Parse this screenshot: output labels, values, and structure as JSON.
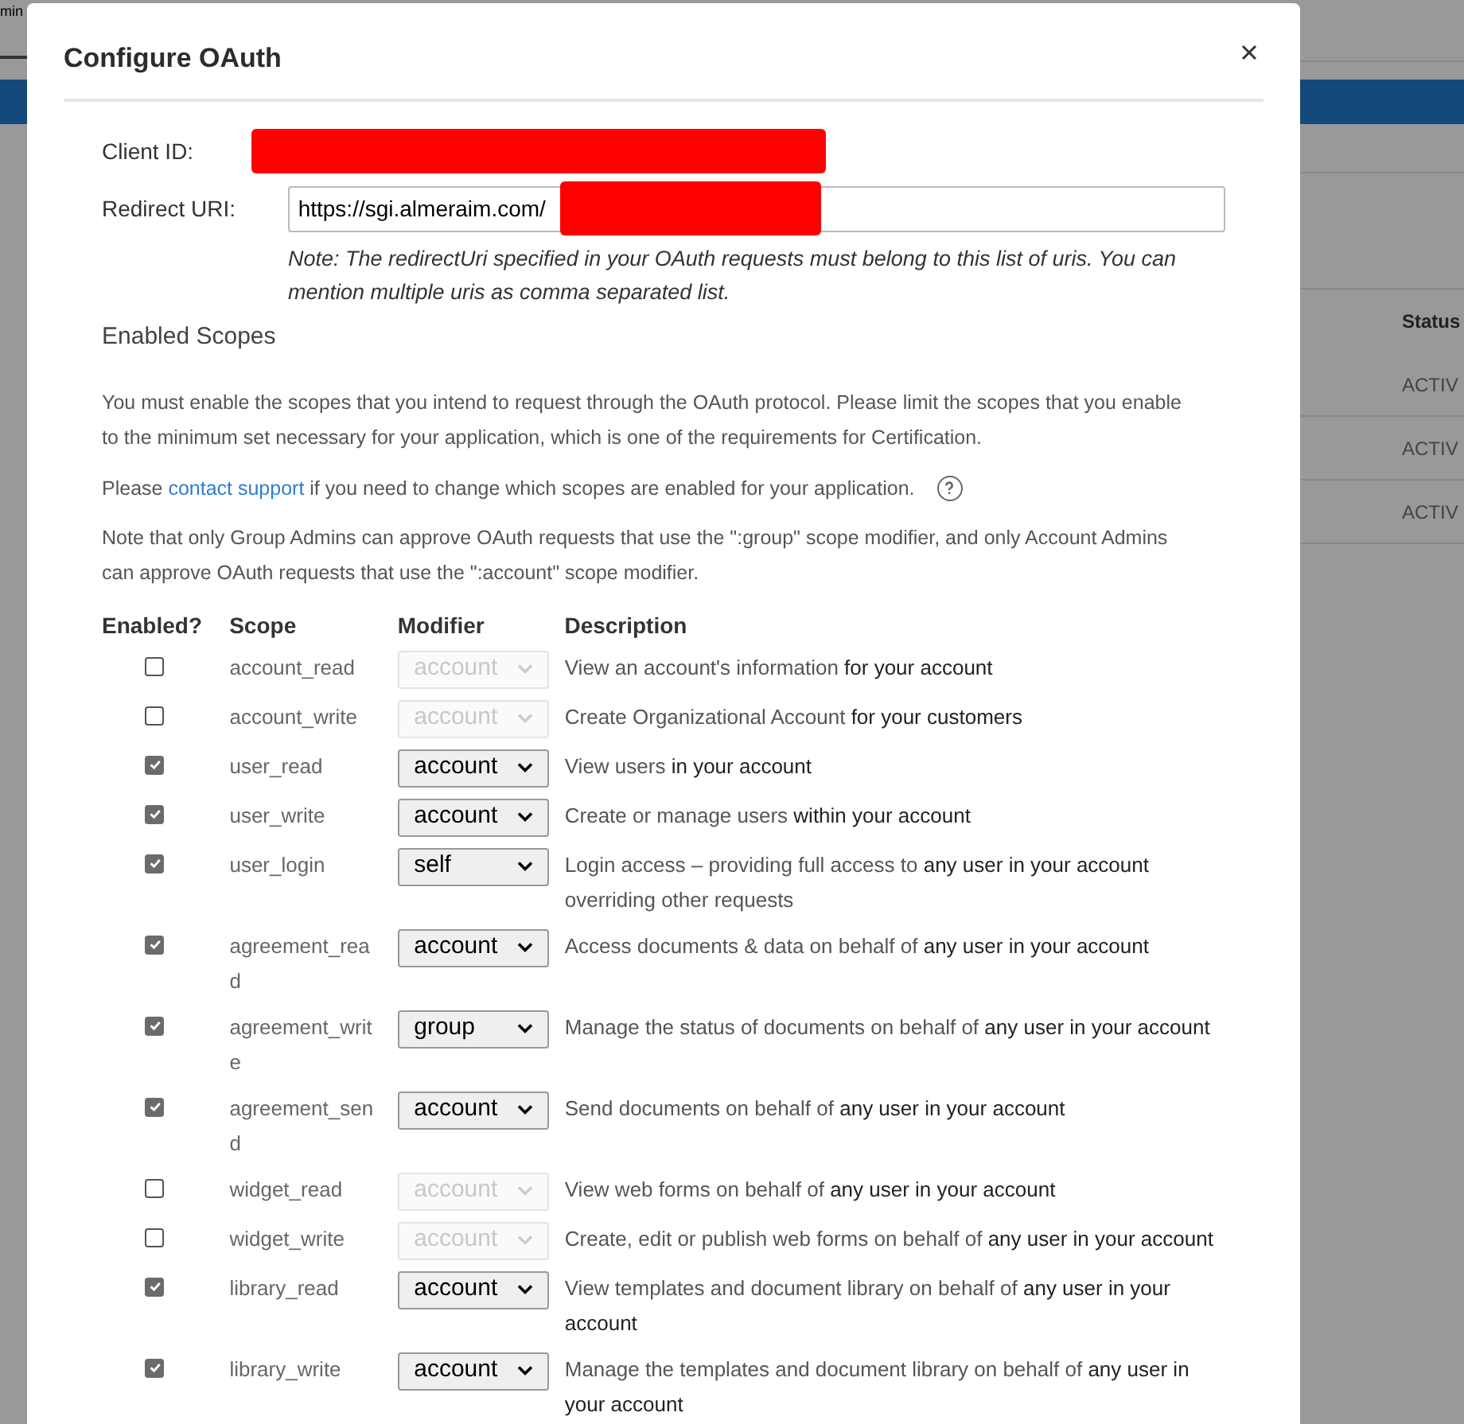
{
  "background": {
    "tab_label": "min",
    "status_header": "Status",
    "status_cells": [
      "ACTIV",
      "ACTIV",
      "ACTIV"
    ]
  },
  "dialog": {
    "title": "Configure OAuth",
    "client_id": {
      "label": "Client ID:"
    },
    "redirect_uri": {
      "label": "Redirect URI:",
      "value": "https://sgi.almeraim.com/"
    },
    "note": "Note: The redirectUri specified in your OAuth requests must belong to this list of uris. You can mention multiple uris as comma separated list.",
    "section_title": "Enabled Scopes",
    "intro": "You must enable the scopes that you intend to request through the OAuth protocol. Please limit the scopes that you enable to the minimum set necessary for your application, which is one of the requirements for Certification.",
    "support": {
      "before": "Please",
      "link": "contact support",
      "after": "if you need to change which scopes are enabled for your application."
    },
    "admin_note": "Note that only Group Admins can approve OAuth requests that use the \":group\" scope modifier, and only Account Admins can approve OAuth requests that use the \":account\" scope modifier.",
    "columns": [
      "Enabled?",
      "Scope",
      "Modifier",
      "Description"
    ],
    "rows": [
      {
        "enabled": false,
        "scope": "account_read",
        "modifier": "account",
        "description": "View an account's information **for your account**"
      },
      {
        "enabled": false,
        "scope": "account_write",
        "modifier": "account",
        "description": "Create Organizational Account **for your customers**"
      },
      {
        "enabled": true,
        "scope": "user_read",
        "modifier": "account",
        "description": "View users **in your account**"
      },
      {
        "enabled": true,
        "scope": "user_write",
        "modifier": "account",
        "description": "Create or manage users **within your account**"
      },
      {
        "enabled": true,
        "scope": "user_login",
        "modifier": "self",
        "description": "Login access – providing full access to **any user in your account** overriding other requests"
      },
      {
        "enabled": true,
        "scope": "agreement_read",
        "modifier": "account",
        "description": "Access documents & data on behalf of **any user in your account**"
      },
      {
        "enabled": true,
        "scope": "agreement_write",
        "modifier": "group",
        "description": "Manage the status of documents on behalf of **any user in your account**"
      },
      {
        "enabled": true,
        "scope": "agreement_send",
        "modifier": "account",
        "description": "Send documents on behalf of **any user in your account**"
      },
      {
        "enabled": false,
        "scope": "widget_read",
        "modifier": "account",
        "description": "View web forms on behalf of **any user in your account**"
      },
      {
        "enabled": false,
        "scope": "widget_write",
        "modifier": "account",
        "description": "Create, edit or publish web forms on behalf of **any user in your account**"
      },
      {
        "enabled": true,
        "scope": "library_read",
        "modifier": "account",
        "description": "View templates and document library on behalf of **any user in your account**"
      },
      {
        "enabled": true,
        "scope": "library_write",
        "modifier": "account",
        "description": "Manage the templates and document library on behalf of **any user in your account**"
      }
    ]
  }
}
